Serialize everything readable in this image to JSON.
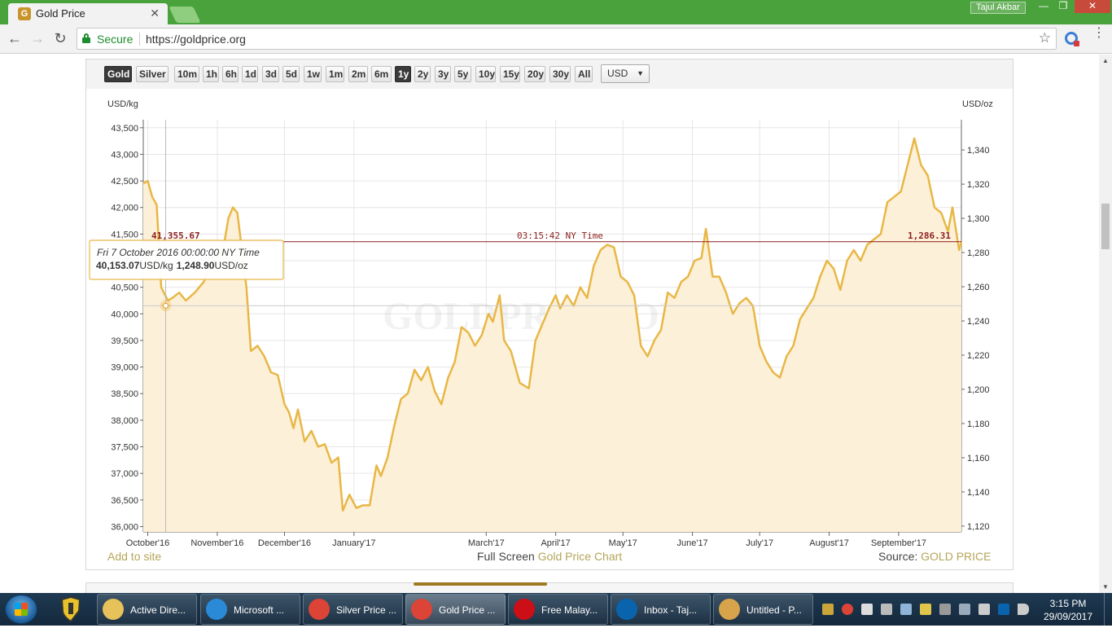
{
  "browser": {
    "tab_title": "Gold Price",
    "tab_icon": "G",
    "tab_close": "✕",
    "user_label": "Tajul Akbar",
    "window_controls": [
      "—",
      "❐",
      "✕"
    ],
    "nav": {
      "back": "←",
      "forward": "→",
      "reload": "↻"
    },
    "secure_label": "Secure",
    "url": "https://goldprice.org",
    "star": "☆",
    "menu": "⋮"
  },
  "widget": {
    "buttons": [
      {
        "label": "Gold",
        "active": true
      },
      {
        "label": "Silver",
        "active": false
      },
      {
        "label": "10m",
        "active": false
      },
      {
        "label": "1h",
        "active": false
      },
      {
        "label": "6h",
        "active": false
      },
      {
        "label": "1d",
        "active": false
      },
      {
        "label": "3d",
        "active": false
      },
      {
        "label": "5d",
        "active": false
      },
      {
        "label": "1w",
        "active": false
      },
      {
        "label": "1m",
        "active": false
      },
      {
        "label": "2m",
        "active": false
      },
      {
        "label": "6m",
        "active": false
      },
      {
        "label": "1y",
        "active": true
      },
      {
        "label": "2y",
        "active": false
      },
      {
        "label": "3y",
        "active": false
      },
      {
        "label": "5y",
        "active": false
      },
      {
        "label": "10y",
        "active": false
      },
      {
        "label": "15y",
        "active": false
      },
      {
        "label": "20y",
        "active": false
      },
      {
        "label": "30y",
        "active": false
      },
      {
        "label": "All",
        "active": false
      }
    ],
    "currency": "USD",
    "currency_arrow": "▼",
    "footer": {
      "add_to_site": "Add to site",
      "fullscreen_prefix": "Full Screen ",
      "fullscreen_link": "Gold Price Chart",
      "source_prefix": "Source: ",
      "source_link": "GOLD PRICE"
    }
  },
  "chart_data": {
    "type": "area",
    "title": "",
    "watermark": "GOLDPRICE.ORG",
    "ylabel_left": "USD/kg",
    "ylabel_right": "USD/oz",
    "y_left_ticks": [
      "43,500",
      "43,000",
      "42,500",
      "42,000",
      "41,500",
      "41,000",
      "40,500",
      "40,000",
      "39,500",
      "39,000",
      "38,500",
      "38,000",
      "37,500",
      "37,000",
      "36,500",
      "36,000"
    ],
    "y_right_ticks": [
      "1,340",
      "1,320",
      "1,300",
      "1,280",
      "1,260",
      "1,240",
      "1,220",
      "1,200",
      "1,180",
      "1,160",
      "1,140",
      "1,120"
    ],
    "ylim_left": [
      35900,
      43650
    ],
    "x_labels": [
      {
        "label": "October'16",
        "date": "2016-10-01"
      },
      {
        "label": "November'16",
        "date": "2016-11-01"
      },
      {
        "label": "December'16",
        "date": "2016-12-01"
      },
      {
        "label": "January'17",
        "date": "2017-01-01"
      },
      {
        "label": "March'17",
        "date": "2017-03-01"
      },
      {
        "label": "April'17",
        "date": "2017-04-01"
      },
      {
        "label": "May'17",
        "date": "2017-05-01"
      },
      {
        "label": "June'17",
        "date": "2017-06-01"
      },
      {
        "label": "July'17",
        "date": "2017-07-01"
      },
      {
        "label": "August'17",
        "date": "2017-08-01"
      },
      {
        "label": "September'17",
        "date": "2017-09-01"
      }
    ],
    "xlim": [
      "2016-09-29",
      "2017-09-29"
    ],
    "series": [
      {
        "color": "#e8b745",
        "points": [
          [
            "2016-09-29",
            42450
          ],
          [
            "2016-10-01",
            42500
          ],
          [
            "2016-10-03",
            42200
          ],
          [
            "2016-10-05",
            42050
          ],
          [
            "2016-10-07",
            40500
          ],
          [
            "2016-10-10",
            40250
          ],
          [
            "2016-10-12",
            40300
          ],
          [
            "2016-10-15",
            40400
          ],
          [
            "2016-10-18",
            40250
          ],
          [
            "2016-10-22",
            40400
          ],
          [
            "2016-10-26",
            40600
          ],
          [
            "2016-10-29",
            40900
          ],
          [
            "2016-11-01",
            41050
          ],
          [
            "2016-11-04",
            41300
          ],
          [
            "2016-11-06",
            41800
          ],
          [
            "2016-11-08",
            42000
          ],
          [
            "2016-11-10",
            41900
          ],
          [
            "2016-11-12",
            41200
          ],
          [
            "2016-11-14",
            40500
          ],
          [
            "2016-11-16",
            39300
          ],
          [
            "2016-11-19",
            39400
          ],
          [
            "2016-11-22",
            39200
          ],
          [
            "2016-11-25",
            38900
          ],
          [
            "2016-11-28",
            38850
          ],
          [
            "2016-12-01",
            38300
          ],
          [
            "2016-12-03",
            38150
          ],
          [
            "2016-12-05",
            37850
          ],
          [
            "2016-12-07",
            38200
          ],
          [
            "2016-12-10",
            37600
          ],
          [
            "2016-12-13",
            37800
          ],
          [
            "2016-12-16",
            37500
          ],
          [
            "2016-12-19",
            37550
          ],
          [
            "2016-12-22",
            37200
          ],
          [
            "2016-12-25",
            37300
          ],
          [
            "2016-12-27",
            36300
          ],
          [
            "2016-12-30",
            36600
          ],
          [
            "2017-01-02",
            36350
          ],
          [
            "2017-01-05",
            36400
          ],
          [
            "2017-01-08",
            36400
          ],
          [
            "2017-01-11",
            37150
          ],
          [
            "2017-01-13",
            36950
          ],
          [
            "2017-01-16",
            37300
          ],
          [
            "2017-01-19",
            37900
          ],
          [
            "2017-01-22",
            38400
          ],
          [
            "2017-01-25",
            38500
          ],
          [
            "2017-01-28",
            38950
          ],
          [
            "2017-01-31",
            38750
          ],
          [
            "2017-02-03",
            39000
          ],
          [
            "2017-02-06",
            38550
          ],
          [
            "2017-02-09",
            38300
          ],
          [
            "2017-02-12",
            38800
          ],
          [
            "2017-02-15",
            39100
          ],
          [
            "2017-02-18",
            39750
          ],
          [
            "2017-02-21",
            39650
          ],
          [
            "2017-02-24",
            39400
          ],
          [
            "2017-02-27",
            39600
          ],
          [
            "2017-03-02",
            40000
          ],
          [
            "2017-03-04",
            39850
          ],
          [
            "2017-03-07",
            40350
          ],
          [
            "2017-03-09",
            39500
          ],
          [
            "2017-03-12",
            39300
          ],
          [
            "2017-03-16",
            38700
          ],
          [
            "2017-03-20",
            38600
          ],
          [
            "2017-03-23",
            39500
          ],
          [
            "2017-03-26",
            39800
          ],
          [
            "2017-03-29",
            40100
          ],
          [
            "2017-04-01",
            40350
          ],
          [
            "2017-04-03",
            40100
          ],
          [
            "2017-04-06",
            40350
          ],
          [
            "2017-04-09",
            40150
          ],
          [
            "2017-04-12",
            40500
          ],
          [
            "2017-04-15",
            40300
          ],
          [
            "2017-04-18",
            40900
          ],
          [
            "2017-04-21",
            41200
          ],
          [
            "2017-04-24",
            41300
          ],
          [
            "2017-04-27",
            41250
          ],
          [
            "2017-04-30",
            40700
          ],
          [
            "2017-05-03",
            40600
          ],
          [
            "2017-05-06",
            40350
          ],
          [
            "2017-05-09",
            39400
          ],
          [
            "2017-05-12",
            39200
          ],
          [
            "2017-05-15",
            39500
          ],
          [
            "2017-05-18",
            39700
          ],
          [
            "2017-05-21",
            40400
          ],
          [
            "2017-05-24",
            40300
          ],
          [
            "2017-05-27",
            40600
          ],
          [
            "2017-05-30",
            40700
          ],
          [
            "2017-06-02",
            41000
          ],
          [
            "2017-06-05",
            41050
          ],
          [
            "2017-06-07",
            41600
          ],
          [
            "2017-06-10",
            40700
          ],
          [
            "2017-06-13",
            40700
          ],
          [
            "2017-06-16",
            40400
          ],
          [
            "2017-06-19",
            40000
          ],
          [
            "2017-06-22",
            40200
          ],
          [
            "2017-06-25",
            40300
          ],
          [
            "2017-06-28",
            40150
          ],
          [
            "2017-07-01",
            39400
          ],
          [
            "2017-07-04",
            39100
          ],
          [
            "2017-07-07",
            38900
          ],
          [
            "2017-07-10",
            38800
          ],
          [
            "2017-07-13",
            39200
          ],
          [
            "2017-07-16",
            39400
          ],
          [
            "2017-07-19",
            39900
          ],
          [
            "2017-07-22",
            40100
          ],
          [
            "2017-07-25",
            40300
          ],
          [
            "2017-07-28",
            40700
          ],
          [
            "2017-07-31",
            41000
          ],
          [
            "2017-08-03",
            40850
          ],
          [
            "2017-08-06",
            40450
          ],
          [
            "2017-08-09",
            41000
          ],
          [
            "2017-08-12",
            41200
          ],
          [
            "2017-08-15",
            41000
          ],
          [
            "2017-08-18",
            41300
          ],
          [
            "2017-08-21",
            41400
          ],
          [
            "2017-08-24",
            41500
          ],
          [
            "2017-08-27",
            42100
          ],
          [
            "2017-08-30",
            42200
          ],
          [
            "2017-09-02",
            42300
          ],
          [
            "2017-09-05",
            42800
          ],
          [
            "2017-09-08",
            43300
          ],
          [
            "2017-09-11",
            42800
          ],
          [
            "2017-09-14",
            42600
          ],
          [
            "2017-09-17",
            42000
          ],
          [
            "2017-09-20",
            41900
          ],
          [
            "2017-09-23",
            41550
          ],
          [
            "2017-09-25",
            42000
          ],
          [
            "2017-09-28",
            41200
          ],
          [
            "2017-09-29",
            41356
          ]
        ]
      }
    ],
    "current": {
      "kg_label": "41,355.67",
      "oz_label": "1,286.31",
      "time_label": "03:15:42 NY Time",
      "value": 41355.67
    },
    "tooltip": {
      "date": "Fri 7 October 2016 00:00:00 NY Time",
      "kg_value": "40,153.07",
      "kg_unit": "USD/kg",
      "oz_value": "1,248.90",
      "oz_unit": "USD/oz",
      "x": "2016-10-09",
      "value": 40153.07
    }
  },
  "taskbar": {
    "tasks": [
      {
        "label": "Active Dire...",
        "icon": "ad-icon",
        "color": "#e7c25a",
        "active": false
      },
      {
        "label": "Microsoft ...",
        "icon": "ie-icon",
        "color": "#2b8ad8",
        "active": false
      },
      {
        "label": "Silver Price ...",
        "icon": "chrome-icon",
        "color": "#db4437",
        "active": false
      },
      {
        "label": "Gold Price ...",
        "icon": "chrome-icon",
        "color": "#db4437",
        "active": true
      },
      {
        "label": "Free Malay...",
        "icon": "opera-icon",
        "color": "#cc0f16",
        "active": false
      },
      {
        "label": "Inbox - Taj...",
        "icon": "outlook-icon",
        "color": "#0a64ad",
        "active": false
      },
      {
        "label": "Untitled - P...",
        "icon": "paint-icon",
        "color": "#d8a44b",
        "active": false
      }
    ],
    "time": "3:15 PM",
    "date": "29/09/2017"
  }
}
